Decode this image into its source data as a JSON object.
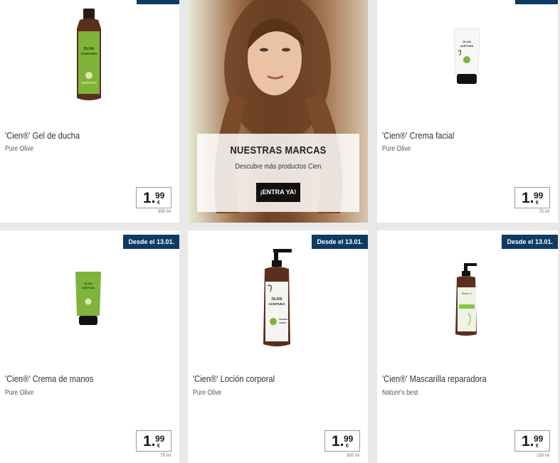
{
  "products": [
    {
      "name": "'Cien®' Gel de ducha",
      "brand": "Pure Olive",
      "price_int": "1.",
      "price_cents": "99",
      "currency": "€",
      "volume": "300 ml",
      "badge": ""
    },
    {
      "name": "'Cien®' Crema facial",
      "brand": "Pure Olive",
      "price_int": "1.",
      "price_cents": "99",
      "currency": "€",
      "volume": "75 ml",
      "badge": ""
    },
    {
      "name": "'Cien®' Crema de manos",
      "brand": "Pure Olive",
      "price_int": "1.",
      "price_cents": "99",
      "currency": "€",
      "volume": "75 ml",
      "badge": "Desde el 13.01."
    },
    {
      "name": "'Cien®' Loción corporal",
      "brand": "Pure Olive",
      "price_int": "1.",
      "price_cents": "99",
      "currency": "€",
      "volume": "300 ml",
      "badge": "Desde el 13.01."
    },
    {
      "name": "'Cien®' Mascarilla reparadora",
      "brand": "Nature's best",
      "price_int": "1.",
      "price_cents": "99",
      "currency": "€",
      "volume": "150 ml",
      "badge": "Desde el 13.01."
    }
  ],
  "promo": {
    "title": "NUESTRAS MARCAS",
    "subtitle": "Descubre más productos Cien",
    "button": "¡ENTRA YA!"
  },
  "labels": {
    "olive_1": "OLIVA",
    "olive_2": "ACEITUNA",
    "natures": "Nature's"
  },
  "colors": {
    "badge": "#0c3b64",
    "olive_green": "#7fb33a",
    "bottle_brown": "#5a2f1e"
  }
}
